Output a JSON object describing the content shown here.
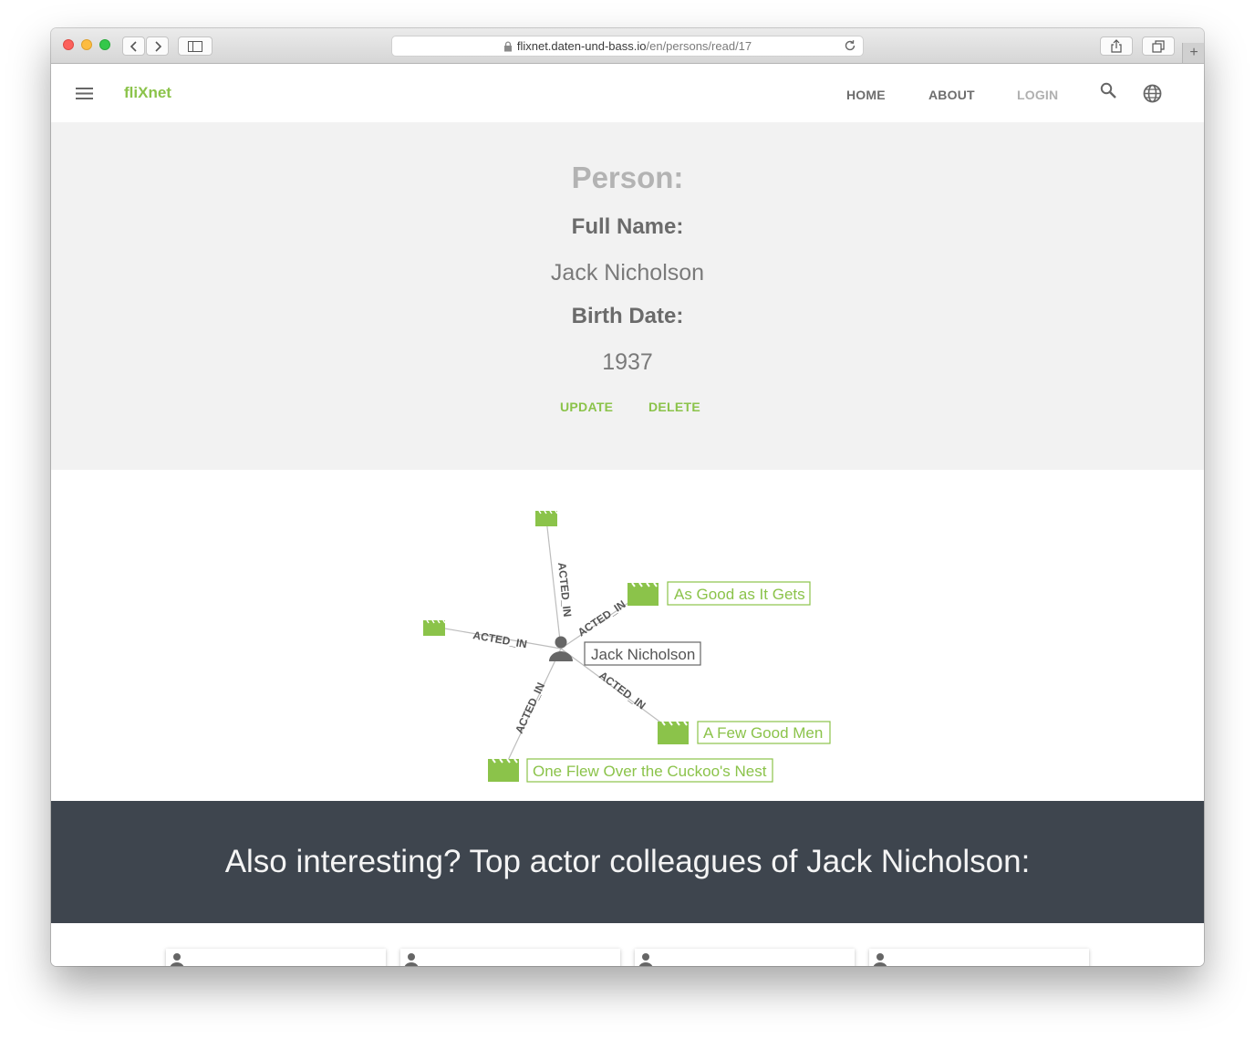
{
  "browser": {
    "url_host": "flixnet.daten-und-bass.io",
    "url_path": "/en/persons/read/17"
  },
  "nav": {
    "brand": "fliXnet",
    "links": [
      "HOME",
      "ABOUT",
      "LOGIN"
    ]
  },
  "person": {
    "heading": "Person:",
    "full_name_label": "Full Name:",
    "full_name": "Jack Nicholson",
    "birth_date_label": "Birth Date:",
    "birth_date": "1937",
    "update_label": "UPDATE",
    "delete_label": "DELETE"
  },
  "graph": {
    "center": "Jack Nicholson",
    "relation": "ACTED_IN",
    "movies": [
      "As Good as It Gets",
      "A Few Good Men",
      "One Flew Over the Cuckoo's Nest",
      "",
      ""
    ]
  },
  "colleagues": {
    "heading": "Also interesting? Top actor colleagues of Jack Nicholson:"
  },
  "colors": {
    "accent": "#8bc34a",
    "dark_band": "#3e454e",
    "person_bg": "#f2f2f2"
  }
}
